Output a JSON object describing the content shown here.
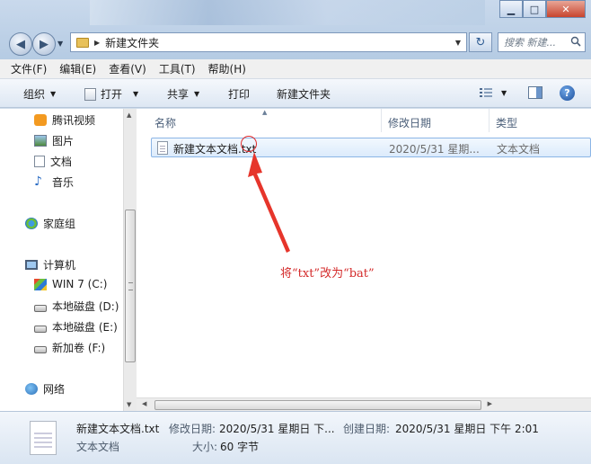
{
  "window": {
    "minimize_glyph": "▁",
    "maximize_glyph": "□",
    "close_glyph": "✕"
  },
  "address": {
    "path": "新建文件夹",
    "search_placeholder": "搜索 新建..."
  },
  "menu": [
    "文件(F)",
    "编辑(E)",
    "查看(V)",
    "工具(T)",
    "帮助(H)"
  ],
  "toolbar": {
    "organize": "组织",
    "open": "打开",
    "share": "共享",
    "print": "打印",
    "new_folder": "新建文件夹"
  },
  "nav": {
    "tencent_video": "腾讯视频",
    "pictures": "图片",
    "documents": "文档",
    "music": "音乐",
    "homegroup": "家庭组",
    "computer": "计算机",
    "drive_c": "WIN 7 (C:)",
    "drive_d": "本地磁盘 (D:)",
    "drive_e": "本地磁盘 (E:)",
    "drive_f": "新加卷 (F:)",
    "network": "网络"
  },
  "columns": {
    "name": "名称",
    "modified": "修改日期",
    "type": "类型"
  },
  "file": {
    "name": "新建文本文档.txt",
    "modified": "2020/5/31 星期...",
    "type": "文本文档"
  },
  "annotation": "将“txt”改为“bat”",
  "details": {
    "name": "新建文本文档.txt",
    "type": "文本文档",
    "modified_label": "修改日期:",
    "modified_value": "2020/5/31 星期日 下...",
    "created_label": "创建日期:",
    "created_value": "2020/5/31 星期日 下午 2:01",
    "size_label": "大小:",
    "size_value": "60 字节"
  },
  "colors": {
    "annotation": "#d42a2a",
    "selection_border": "#8bb5e6"
  }
}
